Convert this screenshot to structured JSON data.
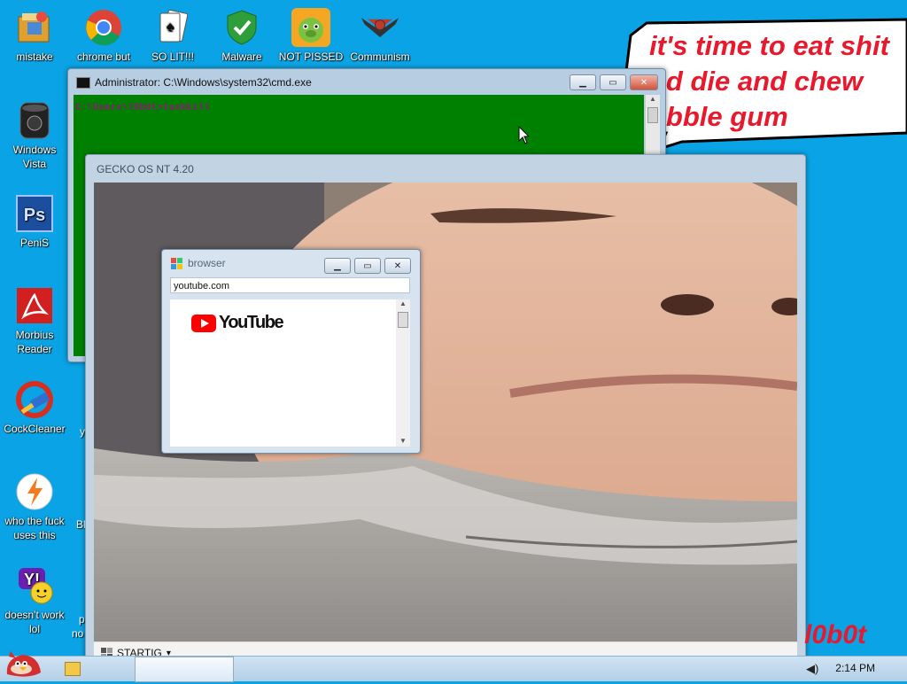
{
  "desktop": {
    "icons": [
      {
        "label": "mistake",
        "icon": "folder-icon"
      },
      {
        "label": "chrome but",
        "icon": "chrome-icon"
      },
      {
        "label": "SO LIT!!!",
        "icon": "solitaire-icon"
      },
      {
        "label": "Malware",
        "icon": "shield-icon"
      },
      {
        "label": "NOT PISSED",
        "icon": "angry-pig-icon"
      },
      {
        "label": "Communism",
        "icon": "hammer-sickle-icon"
      },
      {
        "label": "Windows Vista",
        "icon": "vista-orb-icon"
      },
      {
        "label": "PeniS",
        "icon": "photoshop-icon"
      },
      {
        "label": "Morbius Reader",
        "icon": "pdf-reader-icon"
      },
      {
        "label": "CockCleaner",
        "icon": "ccleaner-icon"
      },
      {
        "label": "who the fuck uses this",
        "icon": "winamp-icon"
      },
      {
        "label": "doesn't work lol",
        "icon": "yahoo-messenger-icon"
      }
    ],
    "speech_bubble_text": "it's time to eat shit\nnd die and chew\nubble gum",
    "bottom_right_text": "l0b0t",
    "partial_labels": {
      "y": "y",
      "bl": "Bl",
      "p": "p",
      "no": "no"
    }
  },
  "cmd_window": {
    "title": "Administrator: C:\\Windows\\system32\\cmd.exe",
    "prompt_text": "C:\\Users\\l0b0t>taskkill"
  },
  "gecko_window": {
    "title": "GECKO OS NT 4.20",
    "start_button_label": "STARTIG",
    "start_caret": "▾"
  },
  "browser_window": {
    "title": "browser",
    "url_value": "youtube.com",
    "logo_text": "YouTube"
  },
  "taskbar": {
    "clock": "2:14 PM",
    "volume_icon": "speaker-icon"
  },
  "colors": {
    "desktop_bg": "#0aa4e6",
    "cmd_bg": "#008000",
    "speech_text": "#e8192c",
    "youtube_red": "#ff0000"
  }
}
